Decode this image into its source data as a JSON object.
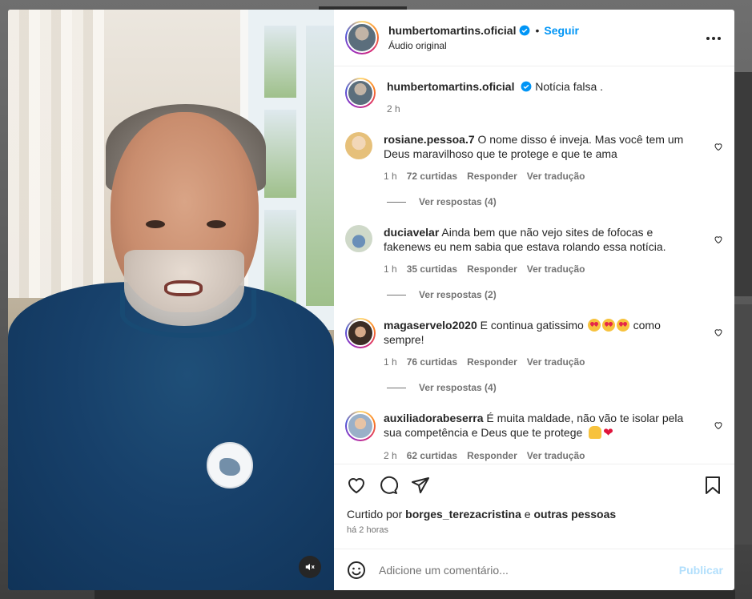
{
  "post": {
    "username": "humbertomartins.oficial",
    "follow_label": "Seguir",
    "audio_label": "Áudio original",
    "caption_text": "Notícia falsa .",
    "caption_time": "2 h"
  },
  "comments": [
    {
      "username": "rosiane.pessoa.7",
      "text": "O nome disso é inveja. Mas você tem um Deus maravilhoso que te protege e que te ama",
      "time": "1 h",
      "likes": "72 curtidas",
      "reply_label": "Responder",
      "translate_label": "Ver tradução",
      "replies_label": "Ver respostas (4)"
    },
    {
      "username": "duciavelar",
      "text": "Ainda bem que não vejo sites de fofocas e fakenews eu nem sabia que estava rolando essa notícia.",
      "time": "1 h",
      "likes": "35 curtidas",
      "reply_label": "Responder",
      "translate_label": "Ver tradução",
      "replies_label": "Ver respostas (2)"
    },
    {
      "username": "magaservelo2020",
      "text_before": "E continua gatissimo",
      "text_after": "como sempre!",
      "time": "1 h",
      "likes": "76 curtidas",
      "reply_label": "Responder",
      "translate_label": "Ver tradução",
      "replies_label": "Ver respostas (4)"
    },
    {
      "username": "auxiliadorabeserra",
      "text": "É muita maldade, não vão te isolar pela sua competência e Deus que te protege",
      "time": "2 h",
      "likes": "62 curtidas",
      "reply_label": "Responder",
      "translate_label": "Ver tradução"
    }
  ],
  "actions": {
    "liked_prefix": "Curtido por",
    "liked_user": "borges_terezacristina",
    "liked_conj": "e",
    "liked_others": "outras pessoas",
    "posted_time": "há 2 horas"
  },
  "composer": {
    "placeholder": "Adicione um comentário...",
    "publish_label": "Publicar"
  },
  "icons": {
    "more": "more-horizontal-icon",
    "like": "heart-icon",
    "comment": "comment-icon",
    "share": "send-icon",
    "save": "bookmark-icon",
    "emoji": "smiley-icon",
    "mute": "volume-muted-icon"
  },
  "colors": {
    "accent": "#0095f6",
    "publish_disabled": "#b2dffc",
    "muted_text": "#737373"
  }
}
